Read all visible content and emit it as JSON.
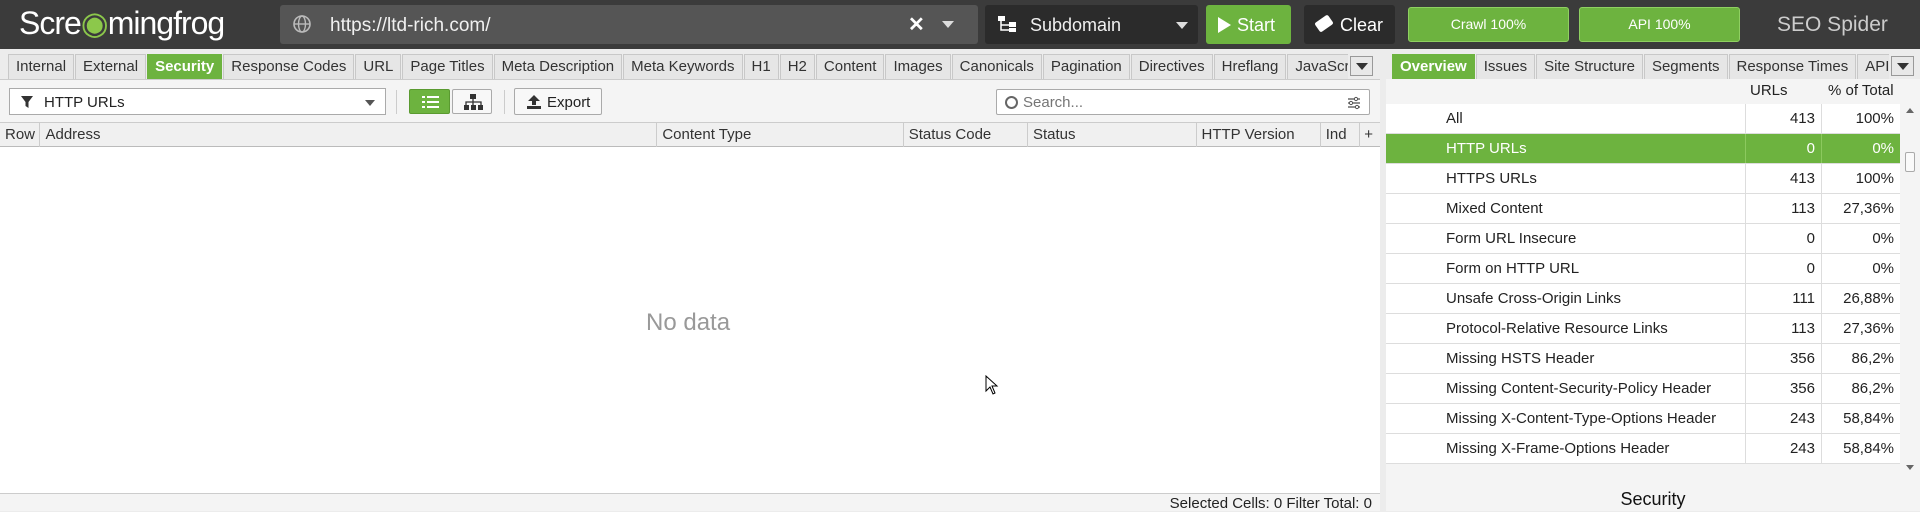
{
  "app": {
    "logo_part1": "Scre",
    "logo_part2": "mingfrog",
    "product": "SEO Spider"
  },
  "toolbar": {
    "url": "https://ltd-rich.com/",
    "mode": "Subdomain",
    "start_label": "Start",
    "clear_label": "Clear",
    "crawl_progress": "Crawl 100%",
    "api_progress": "API 100%"
  },
  "main_tabs": [
    "Internal",
    "External",
    "Security",
    "Response Codes",
    "URL",
    "Page Titles",
    "Meta Description",
    "Meta Keywords",
    "H1",
    "H2",
    "Content",
    "Images",
    "Canonicals",
    "Pagination",
    "Directives",
    "Hreflang",
    "JavaScr"
  ],
  "main_active_tab": "Security",
  "filter": {
    "selected": "HTTP URLs",
    "export_label": "Export",
    "search_placeholder": "Search..."
  },
  "grid": {
    "columns": [
      "Row",
      "Address",
      "Content Type",
      "Status Code",
      "Status",
      "HTTP Version",
      "Ind"
    ],
    "empty_text": "No data"
  },
  "statusbar": {
    "text": "Selected Cells:  0  Filter Total:  0"
  },
  "right_tabs": [
    "Overview",
    "Issues",
    "Site Structure",
    "Segments",
    "Response Times",
    "API"
  ],
  "right_active_tab": "Overview",
  "overview": {
    "col_urls": "URLs",
    "col_pct": "% of Total",
    "rows": [
      {
        "name": "All",
        "urls": "413",
        "pct": "100%"
      },
      {
        "name": "HTTP URLs",
        "urls": "0",
        "pct": "0%"
      },
      {
        "name": "HTTPS URLs",
        "urls": "413",
        "pct": "100%"
      },
      {
        "name": "Mixed Content",
        "urls": "113",
        "pct": "27,36%"
      },
      {
        "name": "Form URL Insecure",
        "urls": "0",
        "pct": "0%"
      },
      {
        "name": "Form on HTTP URL",
        "urls": "0",
        "pct": "0%"
      },
      {
        "name": "Unsafe Cross-Origin Links",
        "urls": "111",
        "pct": "26,88%"
      },
      {
        "name": "Protocol-Relative Resource Links",
        "urls": "113",
        "pct": "27,36%"
      },
      {
        "name": "Missing HSTS Header",
        "urls": "356",
        "pct": "86,2%"
      },
      {
        "name": "Missing Content-Security-Policy Header",
        "urls": "356",
        "pct": "86,2%"
      },
      {
        "name": "Missing X-Content-Type-Options Header",
        "urls": "243",
        "pct": "58,84%"
      },
      {
        "name": "Missing X-Frame-Options Header",
        "urls": "243",
        "pct": "58,84%"
      }
    ],
    "selected_row": "HTTP URLs",
    "section_title": "Security"
  }
}
